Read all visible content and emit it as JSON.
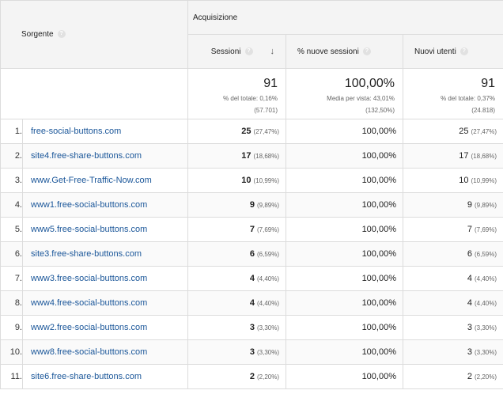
{
  "header": {
    "group_label": "Acquisizione",
    "source_label": "Sorgente",
    "help_glyph": "?",
    "sort_glyph": "↓",
    "columns": {
      "sessions": "Sessioni",
      "new_sessions": "% nuove sessioni",
      "new_users": "Nuovi utenti"
    }
  },
  "totals": {
    "sessions": {
      "value": "91",
      "line1": "% del totale: 0,16%",
      "line2": "(57.701)"
    },
    "new_sessions": {
      "value": "100,00%",
      "line1": "Media per vista: 43,01%",
      "line2": "(132,50%)"
    },
    "new_users": {
      "value": "91",
      "line1": "% del totale: 0,37%",
      "line2": "(24.818)"
    }
  },
  "rows": [
    {
      "index": "1.",
      "source": "free-social-buttons.com",
      "sessions": "25",
      "sessions_pct": "(27,47%)",
      "new_sessions": "100,00%",
      "new_users": "25",
      "new_users_pct": "(27,47%)"
    },
    {
      "index": "2.",
      "source": "site4.free-share-buttons.com",
      "sessions": "17",
      "sessions_pct": "(18,68%)",
      "new_sessions": "100,00%",
      "new_users": "17",
      "new_users_pct": "(18,68%)"
    },
    {
      "index": "3.",
      "source": "www.Get-Free-Traffic-Now.com",
      "sessions": "10",
      "sessions_pct": "(10,99%)",
      "new_sessions": "100,00%",
      "new_users": "10",
      "new_users_pct": "(10,99%)"
    },
    {
      "index": "4.",
      "source": "www1.free-social-buttons.com",
      "sessions": "9",
      "sessions_pct": "(9,89%)",
      "new_sessions": "100,00%",
      "new_users": "9",
      "new_users_pct": "(9,89%)"
    },
    {
      "index": "5.",
      "source": "www5.free-social-buttons.com",
      "sessions": "7",
      "sessions_pct": "(7,69%)",
      "new_sessions": "100,00%",
      "new_users": "7",
      "new_users_pct": "(7,69%)"
    },
    {
      "index": "6.",
      "source": "site3.free-share-buttons.com",
      "sessions": "6",
      "sessions_pct": "(6,59%)",
      "new_sessions": "100,00%",
      "new_users": "6",
      "new_users_pct": "(6,59%)"
    },
    {
      "index": "7.",
      "source": "www3.free-social-buttons.com",
      "sessions": "4",
      "sessions_pct": "(4,40%)",
      "new_sessions": "100,00%",
      "new_users": "4",
      "new_users_pct": "(4,40%)"
    },
    {
      "index": "8.",
      "source": "www4.free-social-buttons.com",
      "sessions": "4",
      "sessions_pct": "(4,40%)",
      "new_sessions": "100,00%",
      "new_users": "4",
      "new_users_pct": "(4,40%)"
    },
    {
      "index": "9.",
      "source": "www2.free-social-buttons.com",
      "sessions": "3",
      "sessions_pct": "(3,30%)",
      "new_sessions": "100,00%",
      "new_users": "3",
      "new_users_pct": "(3,30%)"
    },
    {
      "index": "10.",
      "source": "www8.free-social-buttons.com",
      "sessions": "3",
      "sessions_pct": "(3,30%)",
      "new_sessions": "100,00%",
      "new_users": "3",
      "new_users_pct": "(3,30%)"
    },
    {
      "index": "11.",
      "source": "site6.free-share-buttons.com",
      "sessions": "2",
      "sessions_pct": "(2,20%)",
      "new_sessions": "100,00%",
      "new_users": "2",
      "new_users_pct": "(2,20%)"
    }
  ],
  "colors": {
    "link": "#1a5699",
    "header_bg": "#f4f4f4",
    "border": "#dcdcdc"
  }
}
